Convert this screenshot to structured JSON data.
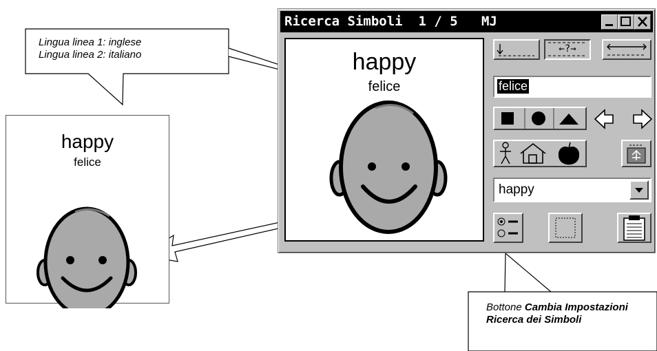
{
  "callout_top": {
    "line1": "Lingua linea 1: inglese",
    "line2": "Lingua linea 2: italiano"
  },
  "callout_bottom": {
    "text_plain": "Bottone ",
    "text_bold": "Cambia Impostazioni Ricerca dei Simboli"
  },
  "card": {
    "word_line1": "happy",
    "word_line2": "felice"
  },
  "window": {
    "title": "Ricerca Simboli  1 / 5   MJ",
    "preview": {
      "word_line1": "happy",
      "word_line2": "felice"
    },
    "search_field": {
      "value": "felice"
    },
    "dropdown": {
      "selected": "happy"
    },
    "tools": {
      "pos_below_label": "↓",
      "pos_unknown_label": "←?→",
      "pos_wide_label": "⟵⟶"
    },
    "colors": {
      "titlebar": "#000000",
      "face": "#c0c0c0",
      "face_fill": "#a9a9a9"
    }
  },
  "icons": [
    "minimize-icon",
    "maximize-icon",
    "close-icon",
    "square-icon",
    "circle-icon",
    "triangle-icon",
    "arrow-left-icon",
    "arrow-right-icon",
    "person-icon",
    "house-icon",
    "apple-icon",
    "frame-symbol-icon",
    "dropdown-arrow-icon",
    "radio-options-icon",
    "dotted-frame-icon",
    "clipboard-icon"
  ]
}
